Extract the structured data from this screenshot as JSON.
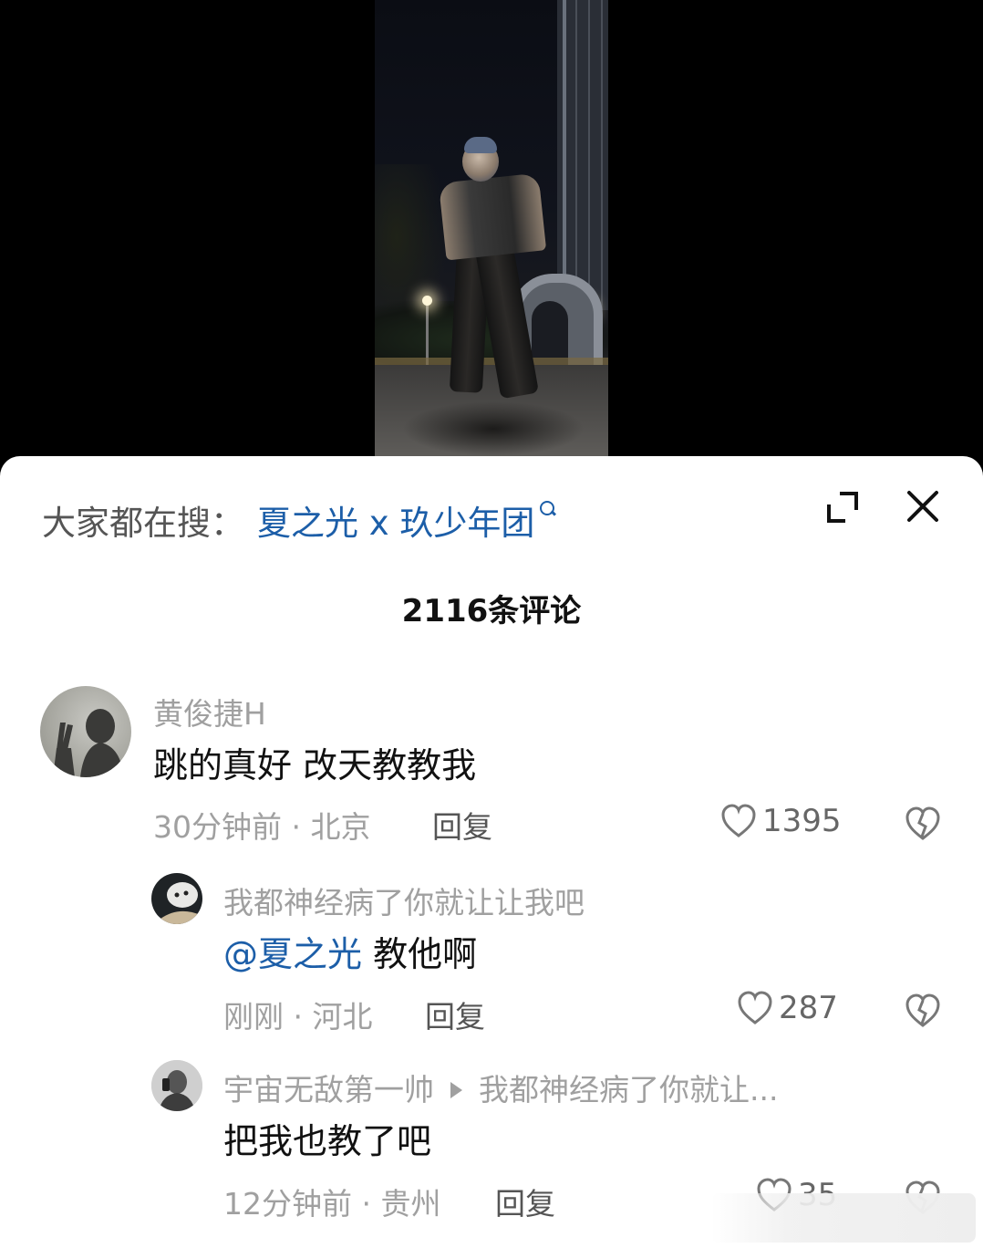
{
  "search": {
    "label": "大家都在搜：",
    "term": "夏之光 x 玖少年团"
  },
  "comments_count": "2116条评论",
  "comments": [
    {
      "username": "黄俊捷H",
      "text": "跳的真好 改天教教我",
      "time_location": "30分钟前 · 北京",
      "reply_label": "回复",
      "likes": "1395"
    },
    {
      "username": "我都神经病了你就让让我吧",
      "mention": "@夏之光",
      "text": " 教他啊",
      "time_location": "刚刚 · 河北",
      "reply_label": "回复",
      "likes": "287"
    },
    {
      "username": "宇宙无敌第一帅",
      "reply_to": "我都神经病了你就让...",
      "text": "把我也教了吧",
      "time_location": "12分钟前 · 贵州",
      "reply_label": "回复",
      "likes": "35"
    }
  ],
  "icons": {
    "expand": "expand-icon",
    "close": "close-icon",
    "like": "heart-icon",
    "dislike": "broken-heart-icon",
    "search": "search-icon"
  }
}
